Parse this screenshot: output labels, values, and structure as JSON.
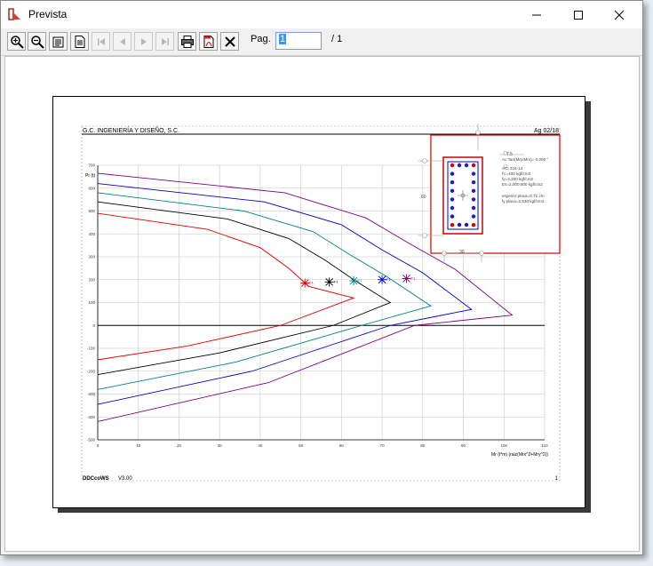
{
  "window": {
    "title": "Prevista",
    "controls": [
      "minimize",
      "maximize",
      "close"
    ]
  },
  "toolbar": {
    "buttons": [
      {
        "name": "zoom-in",
        "icon": "zoom-in-icon",
        "enabled": true
      },
      {
        "name": "zoom-out",
        "icon": "zoom-out-icon",
        "enabled": true
      },
      {
        "name": "page-width",
        "icon": "page-width-icon",
        "enabled": true
      },
      {
        "name": "whole-page",
        "icon": "whole-page-icon",
        "enabled": true
      },
      {
        "name": "first-page",
        "icon": "first-page-icon",
        "enabled": false
      },
      {
        "name": "previous-page",
        "icon": "previous-page-icon",
        "enabled": false
      },
      {
        "name": "next-page",
        "icon": "next-page-icon",
        "enabled": false
      },
      {
        "name": "last-page",
        "icon": "last-page-icon",
        "enabled": false
      },
      {
        "name": "print",
        "icon": "printer-icon",
        "enabled": true
      },
      {
        "name": "export-pdf",
        "icon": "pdf-icon",
        "enabled": true
      },
      {
        "name": "close-preview",
        "icon": "close-x-icon",
        "enabled": true
      }
    ],
    "page_label": "Pag.",
    "page_value": "1",
    "page_total": "/ 1"
  },
  "report": {
    "header_left": "G.C. INGENIERÍA Y DISEÑO, S.C.",
    "header_right": "Ag 02/18",
    "footer_left": "DDCcoWS",
    "footer_version": "V3.00",
    "footer_right": "1"
  },
  "chart_data": {
    "type": "line",
    "ylabel": "Pr (t)",
    "xlabel": "Mr (t*m) (raiz(Mrx^2+Mry^2))",
    "xlim": [
      0,
      110
    ],
    "ylim": [
      -500,
      700
    ],
    "xticks": [
      0,
      10,
      20,
      30,
      40,
      50,
      60,
      70,
      80,
      90,
      100,
      110
    ],
    "yticks": [
      -500,
      -400,
      -300,
      -200,
      -100,
      0,
      100,
      200,
      300,
      400,
      500,
      600,
      700
    ],
    "grid": true,
    "colors": [
      "#e00000",
      "#000000",
      "#008080",
      "#0000cc",
      "#800080"
    ],
    "series": [
      {
        "x": [
          0,
          27,
          40,
          47,
          52,
          63,
          45,
          22,
          0
        ],
        "y": [
          490,
          420,
          340,
          250,
          170,
          120,
          0,
          -90,
          -150
        ]
      },
      {
        "x": [
          0,
          32,
          47,
          56,
          63,
          72,
          58,
          30,
          0
        ],
        "y": [
          540,
          465,
          380,
          285,
          200,
          100,
          0,
          -120,
          -215
        ]
      },
      {
        "x": [
          0,
          36,
          53,
          62,
          71,
          82,
          65,
          34,
          0
        ],
        "y": [
          580,
          500,
          410,
          310,
          215,
          85,
          0,
          -160,
          -280
        ]
      },
      {
        "x": [
          0,
          41,
          60,
          70,
          80,
          92,
          72,
          38,
          0
        ],
        "y": [
          620,
          540,
          440,
          330,
          230,
          70,
          0,
          -200,
          -345
        ]
      },
      {
        "x": [
          0,
          46,
          66,
          77,
          88,
          102,
          78,
          42,
          0
        ],
        "y": [
          665,
          580,
          470,
          355,
          245,
          45,
          0,
          -250,
          -420
        ]
      }
    ],
    "markers": [
      {
        "x": 51,
        "y": 185,
        "label": "F1"
      },
      {
        "x": 57,
        "y": 190,
        "label": "F1"
      },
      {
        "x": 63,
        "y": 195,
        "label": "F1"
      },
      {
        "x": 70,
        "y": 200,
        "label": "F1"
      },
      {
        "x": 76,
        "y": 205,
        "label": "F1"
      }
    ]
  },
  "section": {
    "dim_top": "7.5",
    "dim_side": "60",
    "dim_bottom": "30",
    "lines": [
      "Ac.Tan(Mry/Mrx)= 0.000 °",
      "ACI 318-14",
      "f'c=400 kgf/cm2",
      "fy=4,200 kgf/cm2",
      "Es=2,000,000 kgf/cm2",
      "espesor placa=0.71 cm",
      "fy placa=2,530 kgf/cm2"
    ]
  }
}
